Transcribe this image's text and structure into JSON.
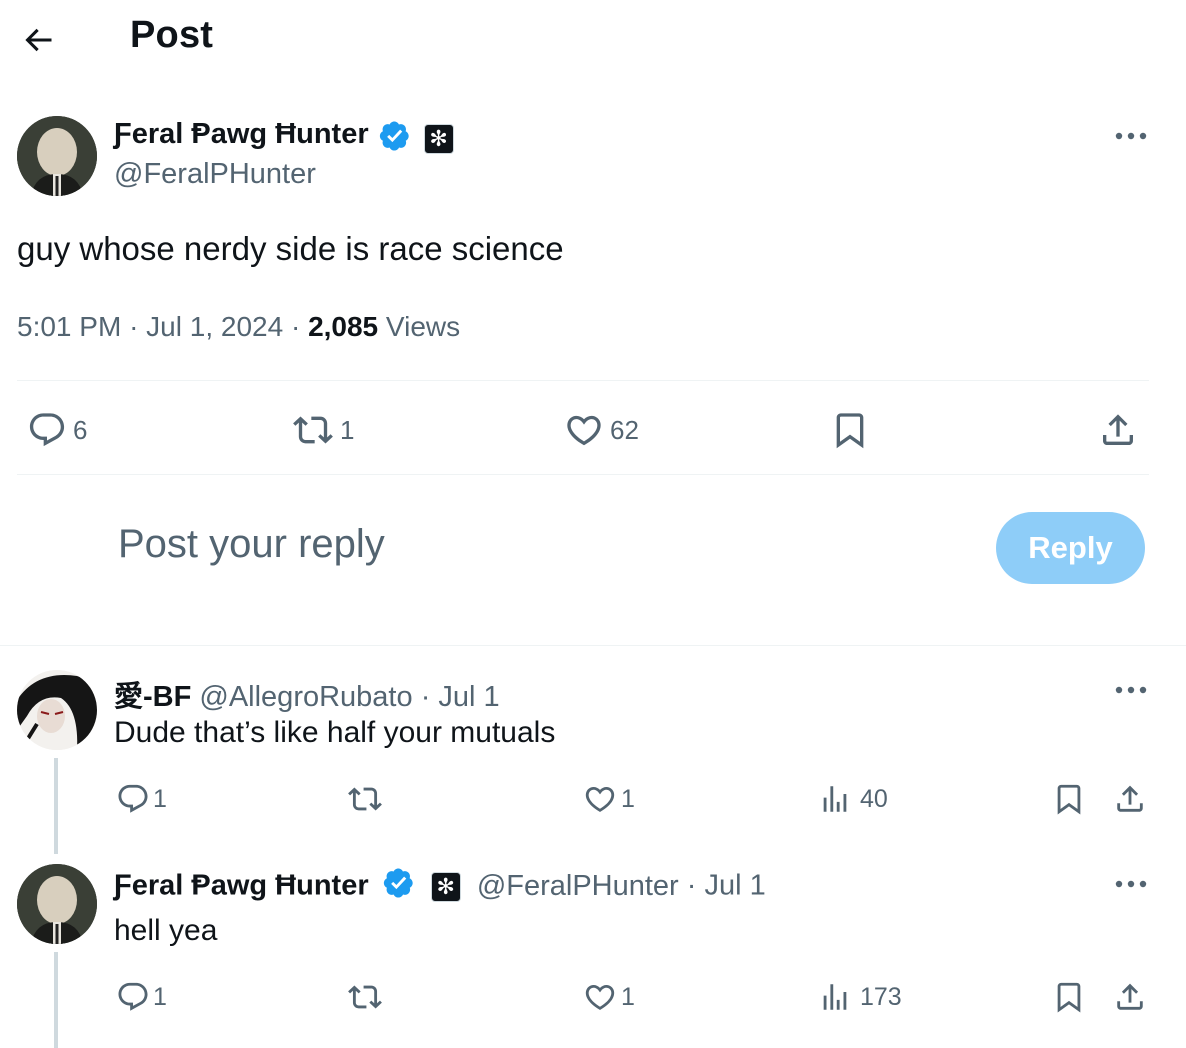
{
  "header": {
    "title": "Post"
  },
  "post": {
    "author_name": "Ƒeral Ᵽawg Ħunter",
    "author_handle": "@FeralPHunter",
    "text": "guy whose nerdy side is race science",
    "time": "5:01 PM",
    "date": "Jul 1, 2024",
    "views_count": "2,085",
    "views_label": "Views",
    "replies": "6",
    "reposts": "1",
    "likes": "62"
  },
  "composer": {
    "placeholder": "Post your reply",
    "button": "Reply"
  },
  "replies": [
    {
      "name": "愛-BF",
      "handle": "@AllegroRubato",
      "date": "Jul 1",
      "text": "Dude that’s like half your mutuals",
      "replies": "1",
      "likes": "1",
      "views": "40"
    },
    {
      "name": "Ƒeral Ᵽawg Ħunter",
      "handle": "@FeralPHunter",
      "date": "Jul 1",
      "text": "hell yea",
      "replies": "1",
      "likes": "1",
      "views": "173"
    }
  ],
  "separator": "·",
  "colors": {
    "accent": "#1d9bf0",
    "reply_button": "#8ecdf8",
    "muted": "#536471",
    "text": "#0f1419"
  },
  "icons": [
    "back-arrow-icon",
    "verified-badge-icon",
    "affiliate-badge-icon",
    "more-icon",
    "reply-icon",
    "repost-icon",
    "like-icon",
    "bookmark-icon",
    "share-icon",
    "views-icon"
  ]
}
